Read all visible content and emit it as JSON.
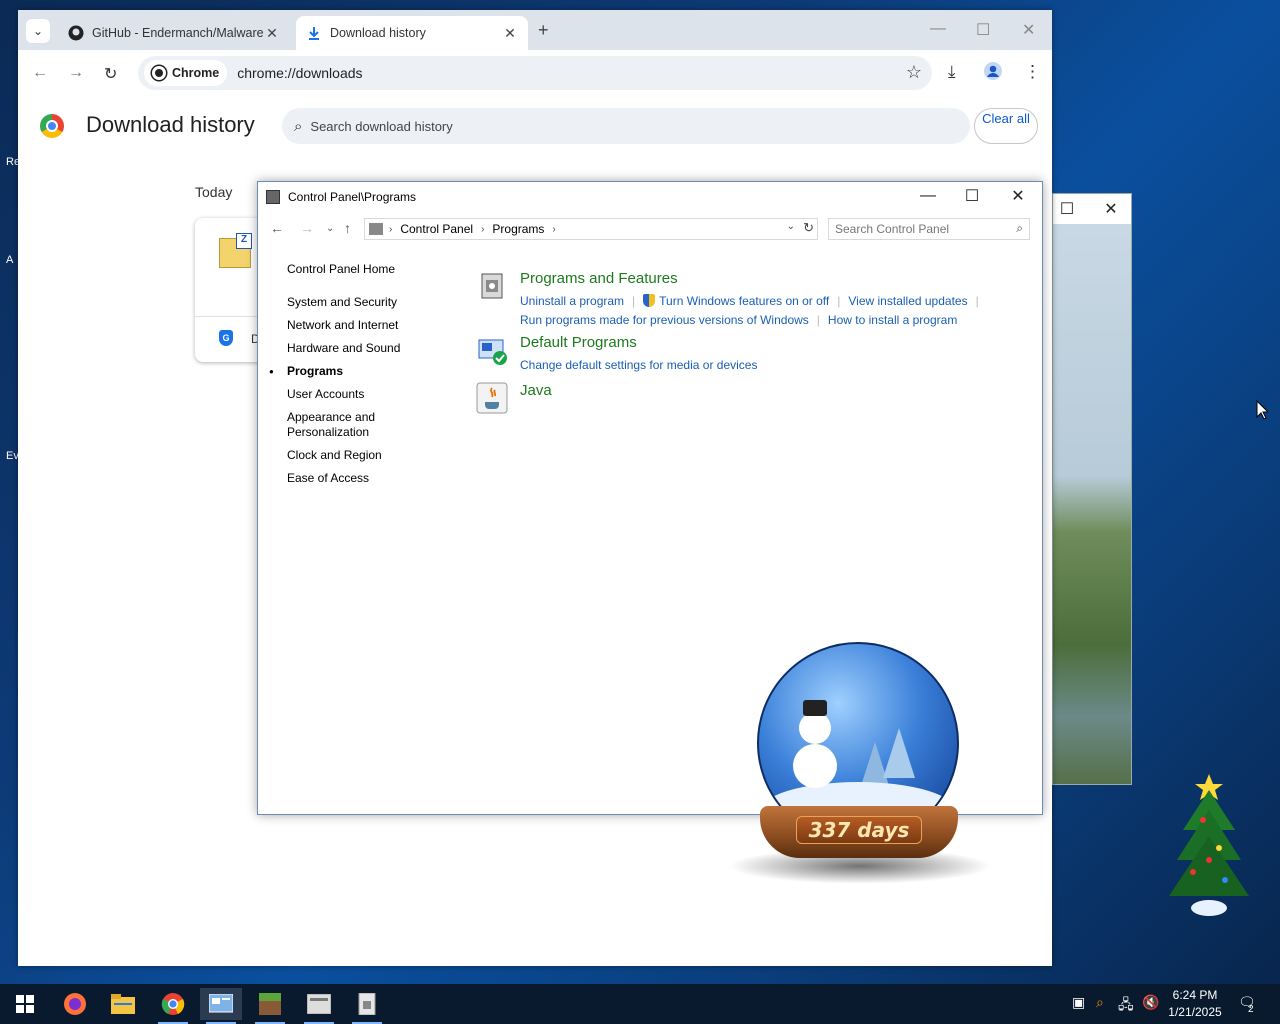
{
  "chrome": {
    "tabs": [
      {
        "label": "GitHub - Endermanch/Malware",
        "icon": "github-icon"
      },
      {
        "label": "Download history",
        "icon": "download-icon"
      }
    ],
    "chip_label": "Chrome",
    "url": "chrome://downloads",
    "page_title": "Download history",
    "search_placeholder": "Search download history",
    "clear_all": "Clear all",
    "today_label": "Today",
    "card_partial": "D"
  },
  "control_panel": {
    "window_title": "Control Panel\\Programs",
    "breadcrumb": [
      "Control Panel",
      "Programs"
    ],
    "search_placeholder": "Search Control Panel",
    "sidebar": [
      {
        "label": "Control Panel Home",
        "active": false
      },
      {
        "label": "System and Security",
        "active": false
      },
      {
        "label": "Network and Internet",
        "active": false
      },
      {
        "label": "Hardware and Sound",
        "active": false
      },
      {
        "label": "Programs",
        "active": true
      },
      {
        "label": "User Accounts",
        "active": false
      },
      {
        "label": "Appearance and Personalization",
        "active": false
      },
      {
        "label": "Clock and Region",
        "active": false
      },
      {
        "label": "Ease of Access",
        "active": false
      }
    ],
    "categories": [
      {
        "heading": "Programs and Features",
        "links_row1": [
          "Uninstall a program",
          "Turn Windows features on or off",
          "View installed updates"
        ],
        "links_row2": [
          "Run programs made for previous versions of Windows",
          "How to install a program"
        ]
      },
      {
        "heading": "Default Programs",
        "links_row1": [
          "Change default settings for media or devices"
        ]
      },
      {
        "heading": "Java"
      }
    ]
  },
  "globe": {
    "counter": "337 days"
  },
  "taskbar": {
    "time": "6:24 PM",
    "date": "1/21/2025",
    "notification_count": "2"
  }
}
